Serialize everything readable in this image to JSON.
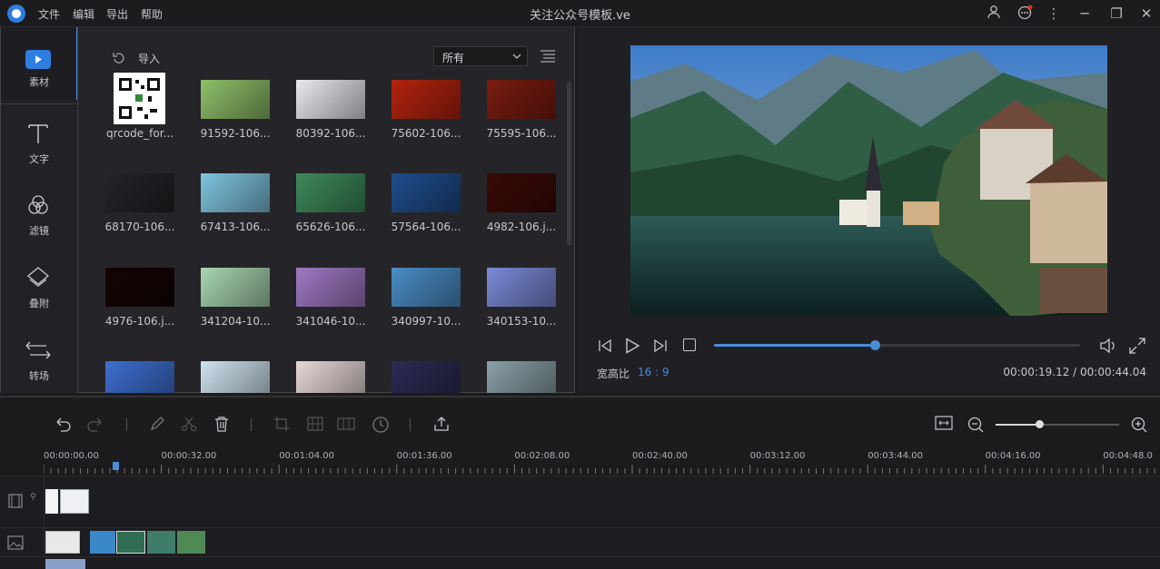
{
  "app": {
    "title": "关注公众号模板.ve",
    "menu": [
      "文件",
      "编辑",
      "导出",
      "帮助"
    ]
  },
  "sidebar": {
    "items": [
      {
        "label": "素材",
        "icon": "media-play-icon"
      },
      {
        "label": "文字",
        "icon": "text-t-icon"
      },
      {
        "label": "滤镜",
        "icon": "filter-circles-icon"
      },
      {
        "label": "叠附",
        "icon": "overlay-diamond-icon"
      },
      {
        "label": "转场",
        "icon": "transition-arrows-icon"
      }
    ]
  },
  "media": {
    "import_label": "导入",
    "filter_value": "所有",
    "items": [
      {
        "caption": "qrcode_for...",
        "color": "#ffffff"
      },
      {
        "caption": "91592-106...",
        "color": "#8fbf6a"
      },
      {
        "caption": "80392-106...",
        "color": "#e9e9ee"
      },
      {
        "caption": "75602-106...",
        "color": "#b3230f"
      },
      {
        "caption": "75595-106...",
        "color": "#7a1c10"
      },
      {
        "caption": "68170-106...",
        "color": "#252529"
      },
      {
        "caption": "67413-106...",
        "color": "#7fc4df"
      },
      {
        "caption": "65626-106...",
        "color": "#3e8a5a"
      },
      {
        "caption": "57564-106...",
        "color": "#1f4c8c"
      },
      {
        "caption": "4982-106.j...",
        "color": "#3a0a05"
      },
      {
        "caption": "4976-106.j...",
        "color": "#140404"
      },
      {
        "caption": "341204-10...",
        "color": "#a9d6b0"
      },
      {
        "caption": "341046-10...",
        "color": "#a07ac4"
      },
      {
        "caption": "340997-10...",
        "color": "#4a8ec7"
      },
      {
        "caption": "340153-10...",
        "color": "#7b8ad8"
      },
      {
        "caption": "",
        "color": "#3e6fd0"
      },
      {
        "caption": "",
        "color": "#cfe3f0"
      },
      {
        "caption": "",
        "color": "#e8d8d8"
      },
      {
        "caption": "",
        "color": "#2b2b55"
      },
      {
        "caption": "",
        "color": "#8aa0a8"
      }
    ]
  },
  "player": {
    "aspect_label": "宽高比",
    "aspect_value": "16 : 9",
    "time": "00:00:19.12 / 00:00:44.04",
    "progress": 0.44
  },
  "timeline": {
    "ticks": [
      "00:00:00.00",
      "00:00:32.00",
      "00:01:04.00",
      "00:01:36.00",
      "00:02:08.00",
      "00:02:40.00",
      "00:03:12.00",
      "00:03:44.00",
      "00:04:16.00",
      "00:04:48.0"
    ],
    "zoom_level": 0.35
  },
  "colors": {
    "accent": "#4a8cd8",
    "background": "#1b1b1e"
  }
}
